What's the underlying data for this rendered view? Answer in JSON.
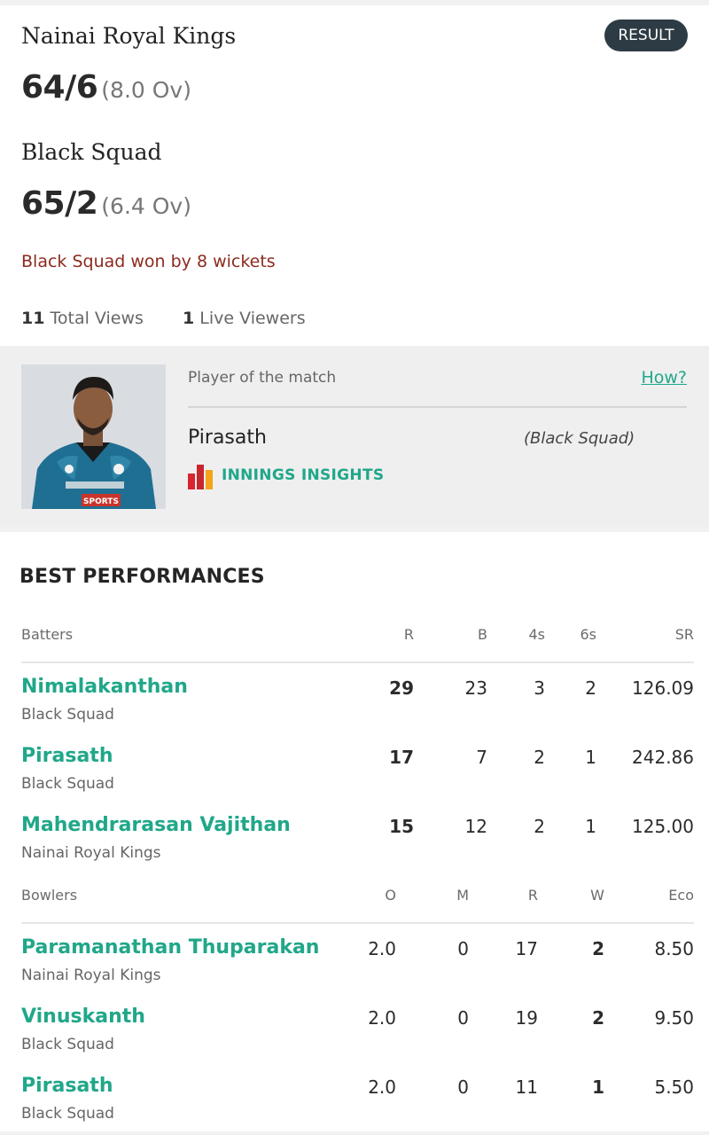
{
  "match": {
    "status_badge": "RESULT",
    "team1": {
      "name": "Nainai Royal Kings",
      "score": "64/6",
      "overs": "(8.0 Ov)"
    },
    "team2": {
      "name": "Black Squad",
      "score": "65/2",
      "overs": "(6.4 Ov)"
    },
    "result": "Black Squad won by 8 wickets",
    "views": {
      "total_count": "11",
      "total_label": "Total Views",
      "live_count": "1",
      "live_label": "Live Viewers"
    }
  },
  "potm": {
    "label": "Player of the match",
    "how_link": "How?",
    "name": "Pirasath",
    "team": "(Black Squad)",
    "insights_label": "INNINGS INSIGHTS",
    "photo_jersey_text": "SPORTS"
  },
  "best": {
    "title": "BEST PERFORMANCES",
    "batters_header": {
      "label": "Batters",
      "c1": "R",
      "c2": "B",
      "c3": "4s",
      "c4": "6s",
      "c5": "SR"
    },
    "batters": [
      {
        "name": "Nimalakanthan",
        "team": "Black Squad",
        "c1": "29",
        "c2": "23",
        "c3": "3",
        "c4": "2",
        "c5": "126.09"
      },
      {
        "name": "Pirasath",
        "team": "Black Squad",
        "c1": "17",
        "c2": "7",
        "c3": "2",
        "c4": "1",
        "c5": "242.86"
      },
      {
        "name": "Mahendrarasan Vajithan",
        "team": "Nainai Royal Kings",
        "c1": "15",
        "c2": "12",
        "c3": "2",
        "c4": "1",
        "c5": "125.00"
      }
    ],
    "bowlers_header": {
      "label": "Bowlers",
      "c1": "O",
      "c2": "M",
      "c3": "R",
      "c4": "W",
      "c5": "Eco"
    },
    "bowlers": [
      {
        "name": "Paramanathan Thuparakan",
        "team": "Nainai Royal Kings",
        "c1": "2.0",
        "c2": "0",
        "c3": "17",
        "c4": "2",
        "c5": "8.50"
      },
      {
        "name": "Vinuskanth",
        "team": "Black Squad",
        "c1": "2.0",
        "c2": "0",
        "c3": "19",
        "c4": "2",
        "c5": "9.50"
      },
      {
        "name": "Pirasath",
        "team": "Black Squad",
        "c1": "2.0",
        "c2": "0",
        "c3": "11",
        "c4": "1",
        "c5": "5.50"
      }
    ]
  },
  "colors": {
    "accent": "#20a789",
    "result_text": "#8c2a1f",
    "badge_bg": "#2d3b44"
  }
}
